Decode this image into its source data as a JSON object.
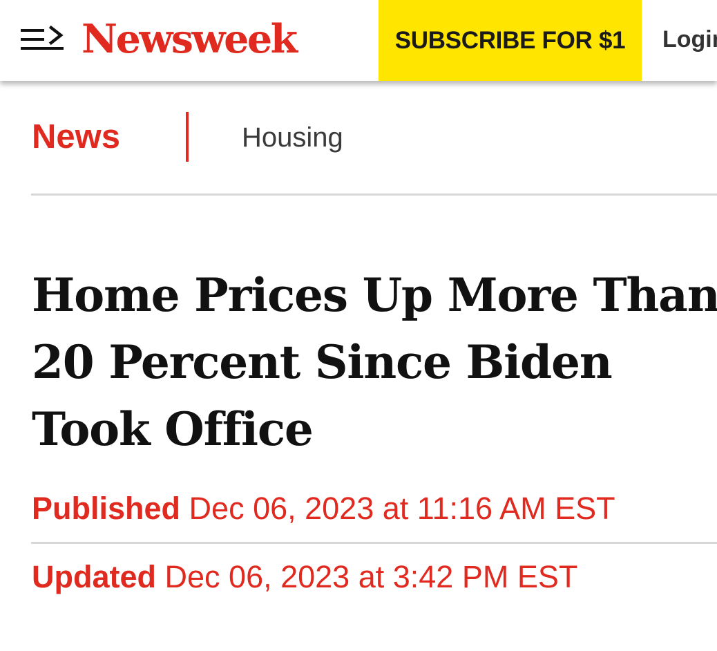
{
  "colors": {
    "brand_red": "#e0291f",
    "subscribe_yellow": "#ffe500"
  },
  "header": {
    "menu_icon": "menu-arrow-icon",
    "logo_text": "Newsweek",
    "subscribe_label": "SUBSCRIBE FOR $1",
    "login_label": "Login"
  },
  "breadcrumb": {
    "section": "News",
    "topic": "Housing"
  },
  "article": {
    "headline": "Home Prices Up More Than 20 Percent Since Biden Took Office",
    "published_label": "Published",
    "published_date": "Dec 06, 2023 at 11:16 AM EST",
    "updated_label": "Updated",
    "updated_date": "Dec 06, 2023 at 3:42 PM EST"
  }
}
